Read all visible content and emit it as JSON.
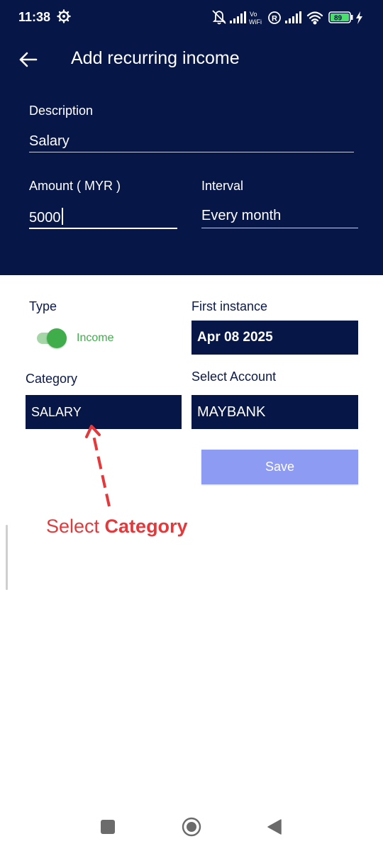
{
  "status_bar": {
    "time": "11:38",
    "volte_label_top": "Vo",
    "volte_label_bottom": "WiFi",
    "roaming_label": "R",
    "battery_percent": "89",
    "icons": [
      "gear-icon",
      "bell-muted-icon",
      "signal-icon",
      "volte-icon",
      "roaming-icon",
      "signal-icon",
      "wifi-icon",
      "battery-icon",
      "charging-icon"
    ]
  },
  "header": {
    "title": "Add recurring income",
    "back_icon": "arrow-left-icon"
  },
  "form": {
    "description": {
      "label": "Description",
      "value": "Salary"
    },
    "amount": {
      "label": "Amount ( MYR )",
      "value": "5000"
    },
    "interval": {
      "label": "Interval",
      "value": "Every month"
    },
    "type": {
      "label": "Type",
      "toggle_label": "Income",
      "checked": true
    },
    "first_instance": {
      "label": "First instance",
      "value": "Apr 08 2025"
    },
    "category": {
      "label": "Category",
      "value": "SALARY"
    },
    "account": {
      "label": "Select Account",
      "value": "MAYBANK"
    },
    "save_label": "Save"
  },
  "annotation": {
    "text_prefix": "Select ",
    "text_bold": "Category"
  },
  "colors": {
    "header_bg": "#061646",
    "accent_green": "#3fae4a",
    "save_button": "#8d9bf2",
    "annotation_red": "#e5383b"
  },
  "nav_bar": {
    "icons": [
      "recents-square-icon",
      "home-circle-icon",
      "back-triangle-icon"
    ]
  }
}
